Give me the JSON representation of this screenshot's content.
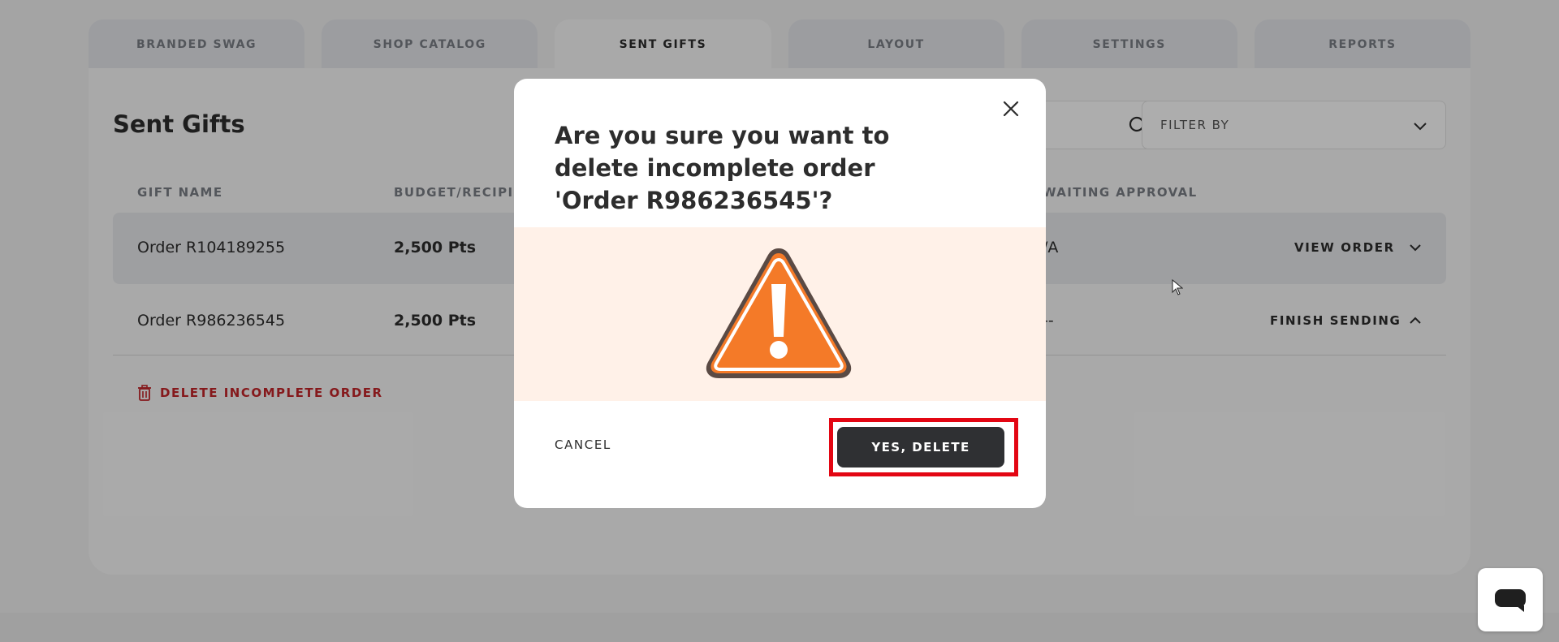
{
  "tabs": [
    {
      "label": "BRANDED SWAG"
    },
    {
      "label": "SHOP CATALOG"
    },
    {
      "label": "SENT GIFTS"
    },
    {
      "label": "LAYOUT"
    },
    {
      "label": "SETTINGS"
    },
    {
      "label": "REPORTS"
    }
  ],
  "panel": {
    "title": "Sent Gifts",
    "filter_label": "FILTER BY"
  },
  "table": {
    "headers": {
      "gift_name": "GIFT NAME",
      "budget": "BUDGET/RECIPIEN",
      "awaiting": "WAITING APPROVAL"
    },
    "rows": [
      {
        "name": "Order R104189255",
        "budget": "2,500 Pts",
        "awaiting": "/A",
        "action": "VIEW ORDER"
      },
      {
        "name": "Order R986236545",
        "budget": "2,500 Pts",
        "awaiting": "--",
        "action": "FINISH SENDING"
      }
    ],
    "delete_link": "DELETE INCOMPLETE ORDER"
  },
  "modal": {
    "title": "Are you sure you want to delete incomplete order 'Order R986236545'?",
    "cancel_label": "CANCEL",
    "confirm_label": "YES, DELETE"
  },
  "colors": {
    "warning_orange": "#f47a28",
    "highlight_red": "#e30613",
    "danger_text": "#c5252a"
  }
}
